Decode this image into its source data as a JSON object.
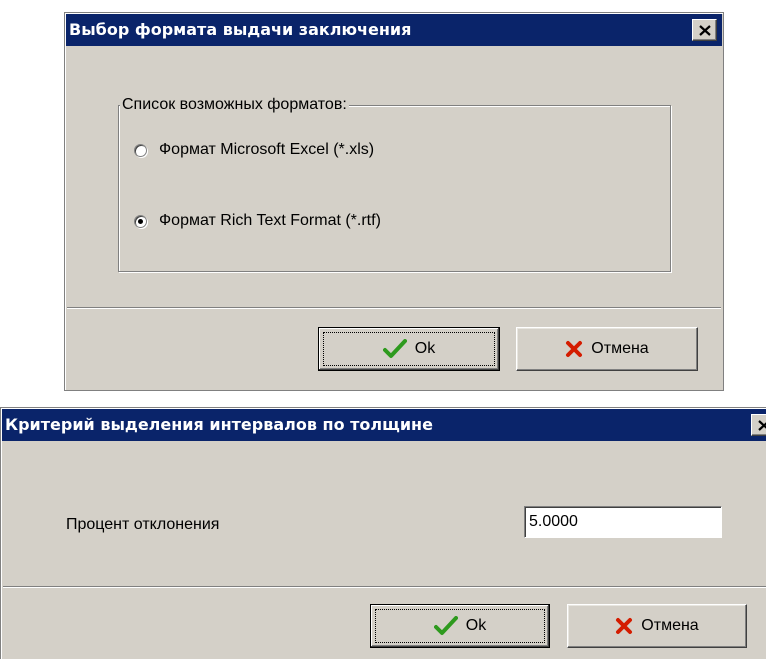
{
  "dialog_format": {
    "title": "Выбор формата выдачи заключения",
    "group_label": "Список возможных форматов:",
    "options": [
      {
        "label": "Формат Microsoft Excel (*.xls)",
        "checked": false
      },
      {
        "label": "Формат Rich Text Format (*.rtf)",
        "checked": true
      }
    ],
    "ok_label": "Ok",
    "cancel_label": "Отмена"
  },
  "dialog_criterion": {
    "title": "Критерий выделения интервалов по толщине",
    "field_label": "Процент отклонения",
    "field_value": "5.0000",
    "ok_label": "Ok",
    "cancel_label": "Отмена"
  },
  "icons": {
    "close": "close-icon",
    "ok": "checkmark-icon",
    "cancel": "red-x-icon"
  },
  "colors": {
    "titlebar": "#0a246a",
    "dialog_face": "#d4d0c8",
    "ok_check": "#2e9a1e",
    "cancel_x": "#d41c00"
  }
}
